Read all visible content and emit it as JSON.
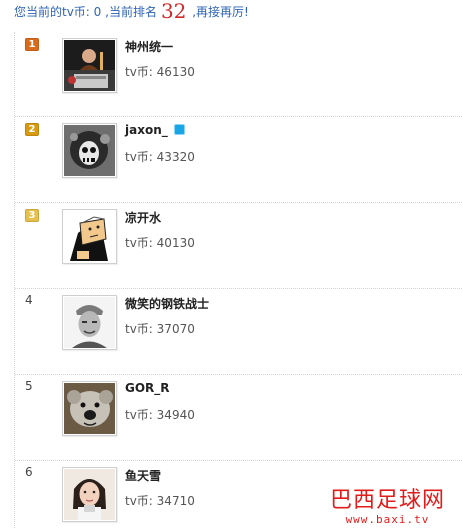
{
  "status": {
    "prefix": "您当前的tv币: ",
    "coins": "0",
    "middle": " ,当前排名",
    "rank": "32",
    "suffix": " ,再接再厉!"
  },
  "leaderboard": [
    {
      "rank": "1",
      "name": "神州统一",
      "coins_label": "tv币: ",
      "coins": "46130",
      "badge_color": "#d96b1c",
      "verified": false
    },
    {
      "rank": "2",
      "name": "jaxon_",
      "coins_label": "tv币: ",
      "coins": "43320",
      "badge_color": "#d79a12",
      "verified": true
    },
    {
      "rank": "3",
      "name": "凉开水",
      "coins_label": "tv币: ",
      "coins": "40130",
      "badge_color": "#e5c04b",
      "verified": false
    },
    {
      "rank": "4",
      "name": "微笑的钢铁战士",
      "coins_label": "tv币: ",
      "coins": "37070",
      "badge_color": "",
      "verified": false
    },
    {
      "rank": "5",
      "name": "GOR_R",
      "coins_label": "tv币: ",
      "coins": "34940",
      "badge_color": "",
      "verified": false
    },
    {
      "rank": "6",
      "name": "鱼天雪",
      "coins_label": "tv币: ",
      "coins": "34710",
      "badge_color": "",
      "verified": false
    }
  ],
  "watermark": {
    "title": "巴西足球网",
    "url": "www.baxi.tv"
  }
}
